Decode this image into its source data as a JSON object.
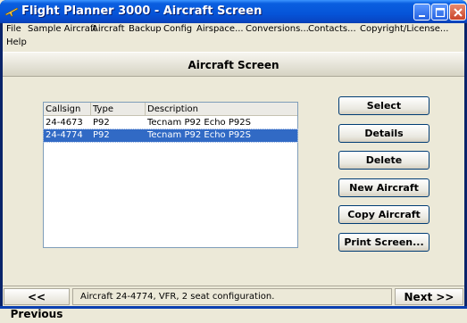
{
  "window": {
    "title": "Flight Planner 3000 - Aircraft Screen",
    "icon": "airplane-icon"
  },
  "menu": {
    "items": [
      {
        "label": "File"
      },
      {
        "label": "Sample Aircraft"
      },
      {
        "label": "Aircraft"
      },
      {
        "label": "Backup"
      },
      {
        "label": "Config"
      },
      {
        "label": "Airspace..."
      },
      {
        "label": "Conversions..."
      },
      {
        "label": "Contacts..."
      },
      {
        "label": "Copyright/License..."
      },
      {
        "label": "Help"
      }
    ]
  },
  "screen": {
    "title": "Aircraft Screen"
  },
  "aircraft_list": {
    "columns": [
      "Callsign",
      "Type",
      "Description"
    ],
    "rows": [
      {
        "callsign": "24-4673",
        "type": "P92",
        "description": "Tecnam P92 Echo P92S"
      },
      {
        "callsign": "24-4774",
        "type": "P92",
        "description": "Tecnam P92 Echo P92S"
      }
    ],
    "selected_callsign": "24-4774"
  },
  "buttons": {
    "select": "Select",
    "details": "Details",
    "delete": "Delete",
    "new_aircraft": "New Aircraft",
    "copy_aircraft": "Copy Aircraft",
    "print_screen": "Print Screen..."
  },
  "status": {
    "previous": "<< Previous",
    "next": "Next >>",
    "message": "Aircraft 24-4774, VFR, 2 seat configuration."
  },
  "colors": {
    "titlebar": "#0654D8",
    "selection": "#316AC5",
    "window_bg": "#ECE9D8"
  }
}
